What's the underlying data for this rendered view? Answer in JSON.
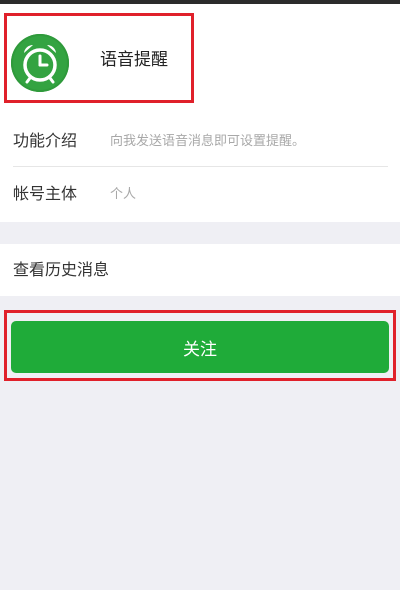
{
  "account": {
    "name": "语音提醒",
    "avatar_icon": "alarm-clock-icon"
  },
  "info": {
    "intro_label": "功能介绍",
    "intro_value": "向我发送语音消息即可设置提醒。",
    "entity_label": "帐号主体",
    "entity_value": "个人"
  },
  "history": {
    "label": "查看历史消息"
  },
  "follow_button": {
    "label": "关注"
  },
  "colors": {
    "primary_green": "#1fab39",
    "highlight_red": "#e0202a",
    "page_background": "#efeff4"
  }
}
